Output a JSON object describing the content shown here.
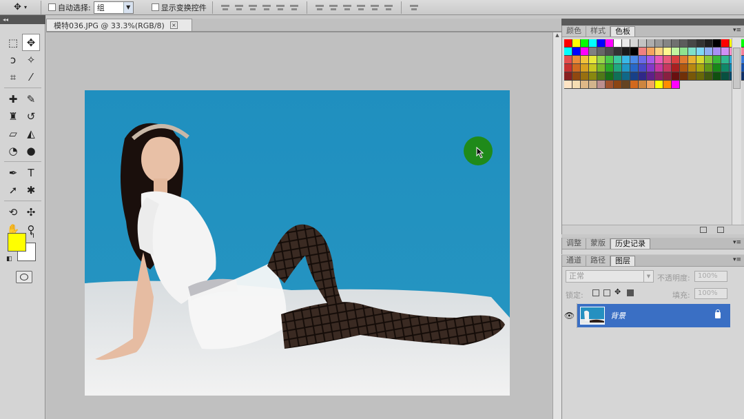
{
  "options_bar": {
    "auto_select_label": "自动选择:",
    "auto_select_value": "组",
    "show_transform_label": "显示变换控件"
  },
  "document": {
    "tab_title": "模特036.JPG @ 33.3%(RGB/8)",
    "close_glyph": "×"
  },
  "tools": [
    {
      "name": "rect-marquee-icon",
      "glyph": "⬚"
    },
    {
      "name": "move-icon",
      "glyph": "✥"
    },
    {
      "name": "lasso-icon",
      "glyph": "ↄ"
    },
    {
      "name": "magic-wand-icon",
      "glyph": "✧"
    },
    {
      "name": "crop-icon",
      "glyph": "⌗"
    },
    {
      "name": "eyedropper-icon",
      "glyph": "⁄"
    },
    {
      "name": "healing-brush-icon",
      "glyph": "✚"
    },
    {
      "name": "brush-icon",
      "glyph": "✎"
    },
    {
      "name": "clone-stamp-icon",
      "glyph": "♜"
    },
    {
      "name": "history-brush-icon",
      "glyph": "↺"
    },
    {
      "name": "eraser-icon",
      "glyph": "▱"
    },
    {
      "name": "paint-bucket-icon",
      "glyph": "◭"
    },
    {
      "name": "blur-icon",
      "glyph": "◔"
    },
    {
      "name": "dodge-icon",
      "glyph": "●"
    },
    {
      "name": "pen-icon",
      "glyph": "✒"
    },
    {
      "name": "type-icon",
      "glyph": "T"
    },
    {
      "name": "path-select-icon",
      "glyph": "➚"
    },
    {
      "name": "custom-shape-icon",
      "glyph": "✱"
    },
    {
      "name": "3d-rotate-icon",
      "glyph": "⟲"
    },
    {
      "name": "3d-camera-icon",
      "glyph": "✣"
    },
    {
      "name": "hand-icon",
      "glyph": "✋"
    },
    {
      "name": "zoom-icon",
      "glyph": "⚲"
    }
  ],
  "colors": {
    "foreground": "#ffff00",
    "background": "#ffffff",
    "swap_glyph": "↰",
    "default_glyph": "◧"
  },
  "swatch_panel": {
    "tabs": [
      "颜色",
      "样式",
      "色板"
    ],
    "active_tab": "色板",
    "menu_glyph": "▾≡"
  },
  "history_panel": {
    "tabs": [
      "调整",
      "蒙版",
      "历史记录"
    ],
    "active_tab": "历史记录",
    "menu_glyph": "▾≡"
  },
  "layers_panel": {
    "tabs": [
      "通道",
      "路径",
      "图层"
    ],
    "active_tab": "图层",
    "menu_glyph": "▾≡",
    "blend_mode": "正常",
    "opacity_label": "不透明度:",
    "opacity_value": "100%",
    "lock_label": "锁定:",
    "fill_label": "填充:",
    "fill_value": "100%",
    "layer_name": "背景",
    "eye_glyph": "👁"
  },
  "swatch_rows": [
    [
      "#ff0000",
      "#ffff00",
      "#00ff00",
      "#00ffff",
      "#0000ff",
      "#ff00ff",
      "#ffffff",
      "#ebebeb",
      "#d6d6d6",
      "#c2c2c2",
      "#adadad",
      "#999999",
      "#858585",
      "#707070",
      "#5c5c5c",
      "#474747",
      "#333333",
      "#1f1f1f",
      "#000000",
      "#ff0000",
      "#ffff00",
      "#00ff00"
    ],
    [
      "#00ffff",
      "#0000ff",
      "#ff00ff",
      "#808080",
      "#666666",
      "#4d4d4d",
      "#333333",
      "#1a1a1a",
      "#000000",
      "#f08080",
      "#f4a460",
      "#ffd27f",
      "#fff68f",
      "#c1f5a0",
      "#8fe38f",
      "#7fe0c8",
      "#7fd8f4",
      "#8fb0f4",
      "#a890f4",
      "#d08ff4",
      "#f48fc8",
      "#f47f9a"
    ],
    [
      "#e54e4e",
      "#ea8a3a",
      "#f0c23a",
      "#e8e83a",
      "#98d64a",
      "#4ac84a",
      "#3ac8a0",
      "#3ab8e8",
      "#4a8ae8",
      "#6a6ae8",
      "#a45ae8",
      "#e85ab8",
      "#e85a7a",
      "#d84040",
      "#e07a30",
      "#e8b030",
      "#d8d830",
      "#88c838",
      "#38b838",
      "#30b890",
      "#30a8d8",
      "#3878d8"
    ],
    [
      "#c83030",
      "#d06a20",
      "#d8a020",
      "#c8c820",
      "#78b828",
      "#28a828",
      "#20a880",
      "#2098c8",
      "#2868c8",
      "#4848c8",
      "#8438c8",
      "#c838a0",
      "#c83860",
      "#a82020",
      "#b05810",
      "#b88810",
      "#a8a810",
      "#609818",
      "#188818",
      "#108868",
      "#1080a8",
      "#1850a8"
    ],
    [
      "#882020",
      "#904810",
      "#987010",
      "#888810",
      "#507818",
      "#187018",
      "#107058",
      "#106888",
      "#184088",
      "#302888",
      "#602088",
      "#882068",
      "#882040",
      "#681010",
      "#703008",
      "#785808",
      "#686808",
      "#405810",
      "#105010",
      "#085040",
      "#084868",
      "#103068"
    ],
    [
      "#ffe4c4",
      "#f5deb3",
      "#deb887",
      "#d2b48c",
      "#bc8f8f",
      "#a0522d",
      "#8b4513",
      "#654321",
      "#d2691e",
      "#cd853f",
      "#f4a460",
      "#ffff00",
      "#ff8c00",
      "#ff00ff"
    ]
  ]
}
